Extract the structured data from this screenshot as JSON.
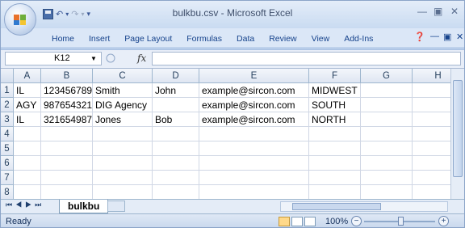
{
  "window": {
    "title": "bulkbu.csv - Microsoft Excel"
  },
  "ribbon": {
    "tabs": [
      "Home",
      "Insert",
      "Page Layout",
      "Formulas",
      "Data",
      "Review",
      "View",
      "Add-Ins"
    ]
  },
  "formula_bar": {
    "name_box": "K12",
    "fx_label": "fx",
    "formula": ""
  },
  "grid": {
    "columns": [
      "A",
      "B",
      "C",
      "D",
      "E",
      "F",
      "G",
      "H"
    ],
    "row_numbers": [
      "1",
      "2",
      "3",
      "4",
      "5",
      "6",
      "7",
      "8"
    ],
    "rows": [
      [
        "IL",
        "123456789",
        "Smith",
        "John",
        "example@sircon.com",
        "MIDWEST",
        "",
        ""
      ],
      [
        "AGY",
        "987654321",
        "DIG Agency",
        "",
        "example@sircon.com",
        "SOUTH",
        "",
        ""
      ],
      [
        "IL",
        "321654987",
        "Jones",
        "Bob",
        "example@sircon.com",
        "NORTH",
        "",
        ""
      ],
      [
        "",
        "",
        "",
        "",
        "",
        "",
        "",
        ""
      ],
      [
        "",
        "",
        "",
        "",
        "",
        "",
        "",
        ""
      ],
      [
        "",
        "",
        "",
        "",
        "",
        "",
        "",
        ""
      ],
      [
        "",
        "",
        "",
        "",
        "",
        "",
        "",
        ""
      ],
      [
        "",
        "",
        "",
        "",
        "",
        "",
        "",
        ""
      ]
    ]
  },
  "sheets": {
    "active": "bulkbu"
  },
  "status": {
    "ready": "Ready",
    "zoom": "100%"
  },
  "icons": [
    "office-button-icon",
    "save-icon",
    "undo-icon",
    "redo-icon",
    "minimize-icon",
    "restore-icon",
    "close-icon",
    "help-icon",
    "fx-icon",
    "new-sheet-icon"
  ]
}
